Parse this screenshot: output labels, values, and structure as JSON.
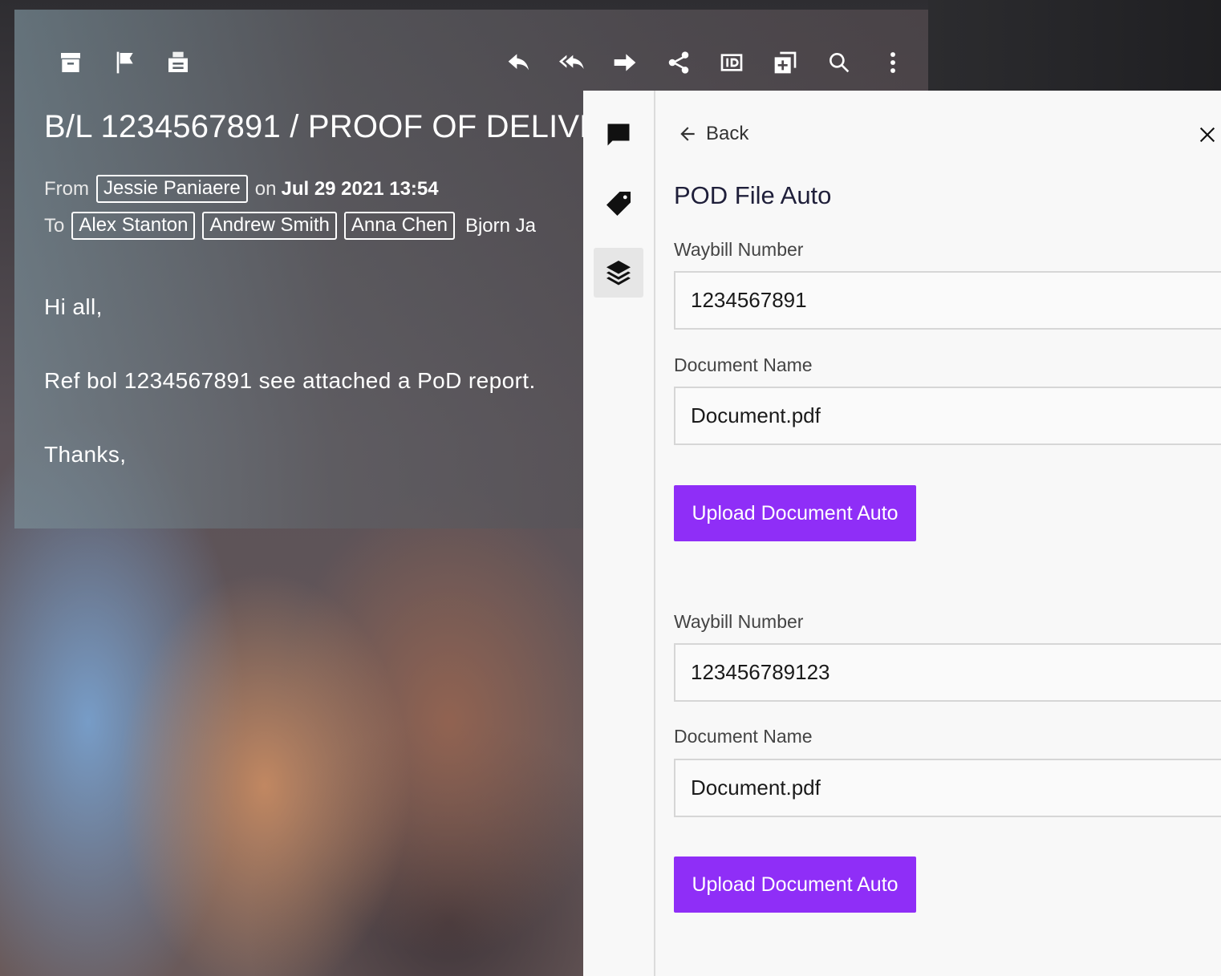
{
  "email": {
    "toolbar_icons": [
      "archive-icon",
      "flag-icon",
      "print-icon",
      "reply-icon",
      "reply-all-icon",
      "forward-icon",
      "share-icon",
      "id-icon",
      "add-copy-icon",
      "search-icon",
      "more-vertical-icon"
    ],
    "subject": "B/L 1234567891 / PROOF OF DELIVE",
    "from_label": "From",
    "from_name": "Jessie Paniaere",
    "on_label": "on",
    "date": "Jul 29 2021 13:54",
    "to_label": "To",
    "recipients": [
      "Alex Stanton",
      "Andrew Smith",
      "Anna Chen"
    ],
    "recipient_overflow": "Bjorn Ja",
    "body": {
      "greeting": "Hi all,",
      "line": "Ref bol 1234567891 see attached a PoD report.",
      "closing": "Thanks,"
    }
  },
  "panel": {
    "rail_icons": [
      "comment-icon",
      "tag-icon",
      "layers-icon"
    ],
    "back_label": "Back",
    "title": "POD File Auto",
    "entries": [
      {
        "waybill_label": "Waybill Number",
        "waybill_value": "1234567891",
        "docname_label": "Document Name",
        "docname_value": "Document.pdf",
        "button_label": "Upload Document Auto"
      },
      {
        "waybill_label": "Waybill Number",
        "waybill_value": "123456789123",
        "docname_label": "Document Name",
        "docname_value": "Document.pdf",
        "button_label": "Upload Document Auto"
      }
    ],
    "accent_color": "#8f2ef7"
  }
}
